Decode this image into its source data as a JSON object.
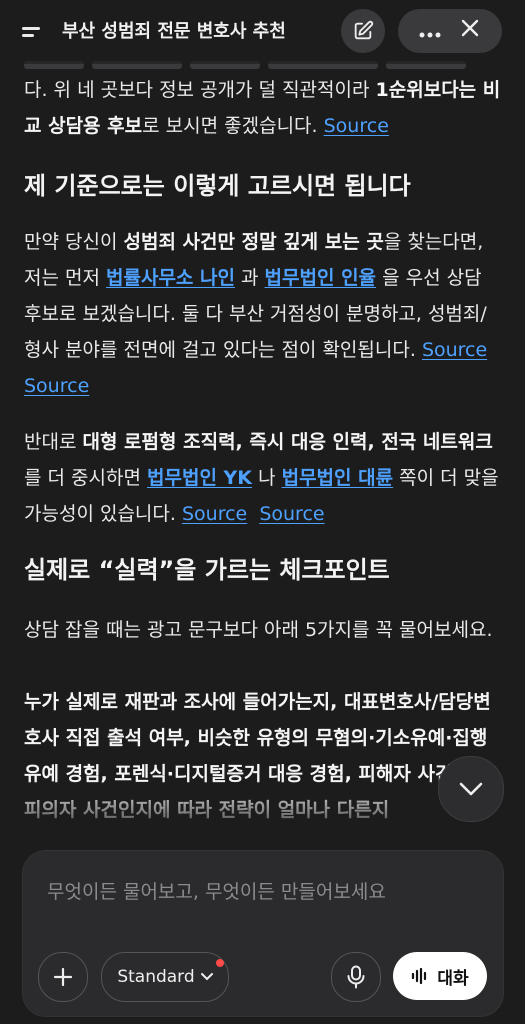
{
  "header": {
    "title": "부산 성범죄 전문 변호사 추천",
    "icons": {
      "menu": "menu-icon",
      "edit": "edit-icon",
      "more": "more-icon",
      "close": "close-icon"
    }
  },
  "content": {
    "para1": {
      "t1": "다. 위 네 곳보다 정보 공개가 덜 직관적이라 ",
      "b1": "1순위보다는 비교 상담용 후보",
      "t2": "로 보시면 좋겠습니다.",
      "source": "Source"
    },
    "heading1": "제 기준으로는 이렇게 고르시면 됩니다",
    "para2": {
      "t1": "만약 당신이 ",
      "b1": "성범죄 사건만 정말 깊게 보는 곳",
      "t2": "을 찾는다면, 저는 먼저 ",
      "link1": "법률사무소 나인",
      "t3": " 과 ",
      "link2": "법무법인 인율",
      "t4": " 을 우선 상담 후보로 보겠습니다. 둘 다 부산 거점성이 분명하고, 성범죄/형사 분야를 전면에 걸고 있다는 점이 확인됩니다.",
      "source1": "Source",
      "source2": "Source"
    },
    "para3": {
      "t1": "반대로 ",
      "b1": "대형 로펌형 조직력, 즉시 대응 인력, 전국 네트워크",
      "t2": "를 더 중시하면 ",
      "link1": "법무법인 YK",
      "t3": " 나 ",
      "link2": "법무법인 대륜",
      "t4": " 쪽이 더 맞을 가능성이 있습니다.",
      "source1": "Source",
      "source2": "Source"
    },
    "heading2": "실제로 “실력”을 가르는 체크포인트",
    "para4": "상담 잡을 때는 광고 문구보다 아래 5가지를 꼭 물어보세요.",
    "para5": "누가 실제로 재판과 조사에 들어가는지, 대표변호사/담당변호사 직접 출석 여부, 비슷한 유형의 무혐의·기소유예·집행유예 경험, 포렌식·디지털증거 대응 경험, 피해자 사건인지 피의자 사건인지에 따라 전략이 얼마나 다른지"
  },
  "composer": {
    "placeholder": "무엇이든 물어보고, 무엇이든 만들어보세요",
    "model_label": "Standard",
    "model_dot_color": "#ff4a4a",
    "voice_label": "대화",
    "icons": {
      "plus": "plus-icon",
      "chevron": "chevron-down-icon",
      "mic": "mic-icon",
      "voice": "waveform-icon",
      "scroll": "chevron-down-icon"
    }
  }
}
